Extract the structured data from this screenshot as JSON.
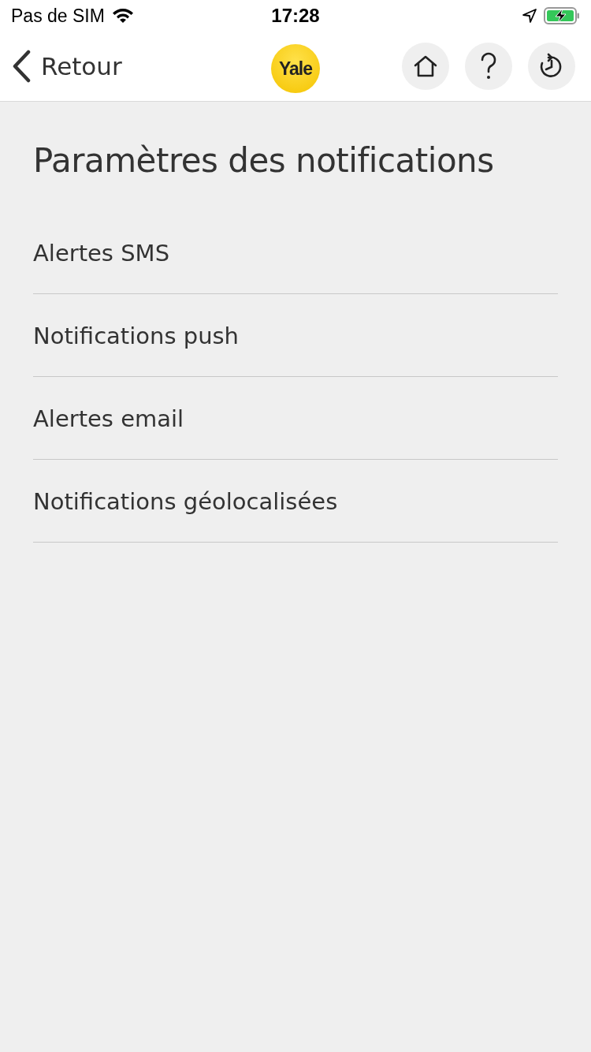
{
  "status_bar": {
    "carrier": "Pas de SIM",
    "time": "17:28"
  },
  "nav_bar": {
    "back_label": "Retour",
    "logo": "Yale"
  },
  "title": "Paramètres des notifications",
  "items": [
    {
      "label": "Alertes SMS"
    },
    {
      "label": "Notifications push"
    },
    {
      "label": "Alertes email"
    },
    {
      "label": "Notifications géolocalisées"
    }
  ]
}
